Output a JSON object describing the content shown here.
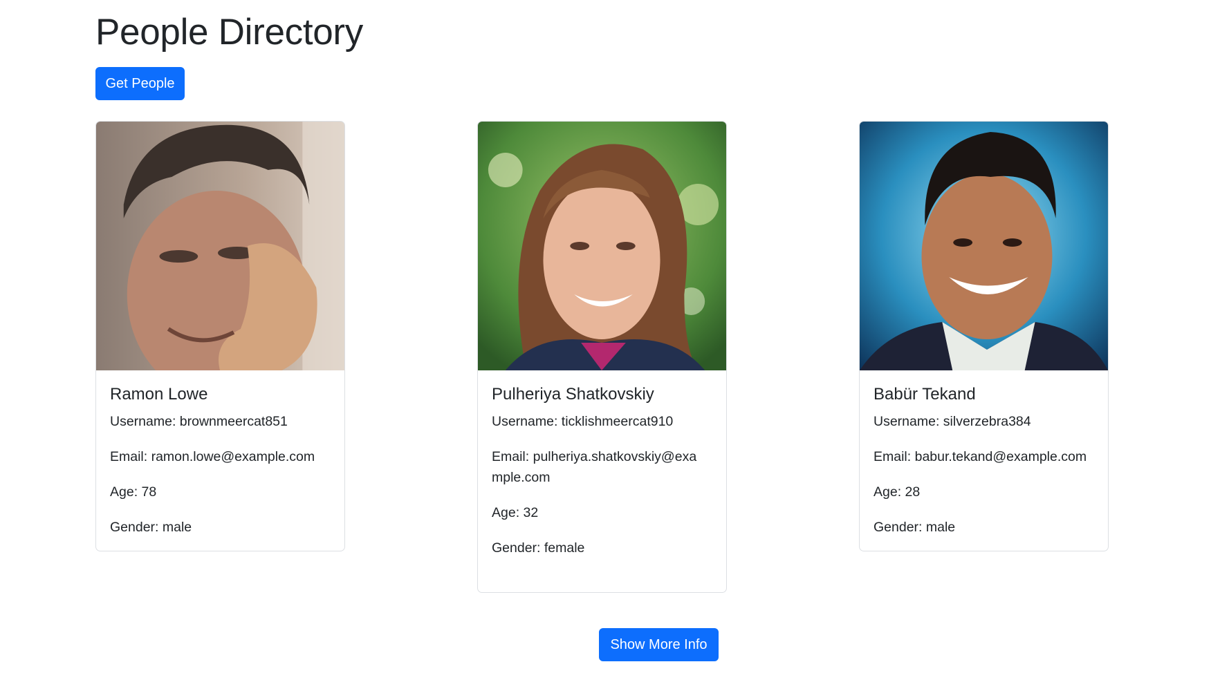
{
  "header": {
    "title": "People Directory"
  },
  "actions": {
    "get_people_label": "Get People",
    "show_more_label": "Show More Info"
  },
  "people": [
    {
      "name": "Ramon Lowe",
      "username_label": "Username: brownmeercat851",
      "email_label": "Email: ramon.lowe@example.com",
      "age_label": "Age: 78",
      "gender_label": "Gender: male"
    },
    {
      "name": "Pulheriya Shatkovskiy",
      "username_label": "Username: ticklishmeercat910",
      "email_label": "Email: pulheriya.shatkovskiy@example.com",
      "age_label": "Age: 32",
      "gender_label": "Gender: female"
    },
    {
      "name": "Babür Tekand",
      "username_label": "Username: silverzebra384",
      "email_label": "Email: babur.tekand@example.com",
      "age_label": "Age: 28",
      "gender_label": "Gender: male"
    }
  ],
  "colors": {
    "primary": "#0d6efd",
    "text": "#212529",
    "card_border": "#dcdfe3"
  }
}
